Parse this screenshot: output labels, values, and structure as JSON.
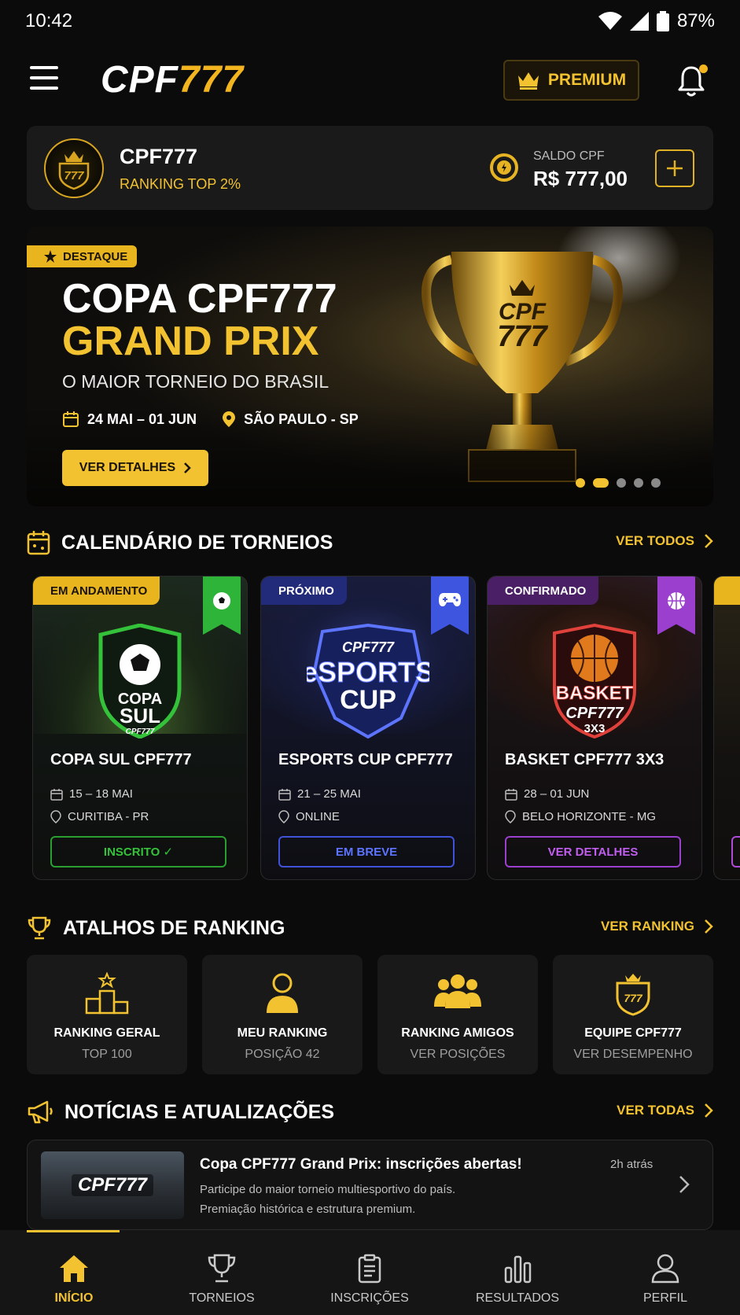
{
  "status_bar": {
    "time": "10:42",
    "battery": "87%"
  },
  "header": {
    "logo_white": "CPF",
    "logo_gold": "777",
    "premium_label": "PREMIUM"
  },
  "user": {
    "name": "CPF777",
    "rank": "RANKING TOP 2%",
    "avatar_text": "777",
    "balance_label": "SALDO CPF",
    "balance_value": "R$ 777,00"
  },
  "hero": {
    "badge": "DESTAQUE",
    "title_line1": "COPA CPF777",
    "title_line2": "GRAND PRIX",
    "subtitle": "O MAIOR TORNEIO DO BRASIL",
    "date": "24 MAI – 01 JUN",
    "location": "SÃO PAULO - SP",
    "cta": "VER DETALHES",
    "trophy_line1": "CPF",
    "trophy_line2": "777",
    "slide_count": 5,
    "active_slide": 2
  },
  "calendar": {
    "title": "CALENDÁRIO DE TORNEIOS",
    "link": "VER TODOS",
    "tournaments": [
      {
        "status": "EM ANDAMENTO",
        "emblem_l1": "COPA",
        "emblem_l2": "SUL",
        "emblem_l3": "CPF777",
        "name": "COPA SUL CPF777",
        "date": "15 – 18 MAI",
        "place": "CURITIBA - PR",
        "button": "INSCRITO ✓",
        "color": "#35c23b"
      },
      {
        "status": "PRÓXIMO",
        "emblem_l1": "CPF777",
        "emblem_l2": "eSPORTS",
        "emblem_l3": "CUP",
        "name": "ESPORTS CUP CPF777",
        "date": "21 – 25 MAI",
        "place": "ONLINE",
        "button": "EM BREVE",
        "color": "#4a5ff0"
      },
      {
        "status": "CONFIRMADO",
        "emblem_l1": "BASKET",
        "emblem_l2": "CPF777",
        "emblem_l3": "3X3",
        "name": "BASKET CPF777 3X3",
        "date": "28 – 01 JUN",
        "place": "BELO HORIZONTE - MG",
        "button": "VER DETALHES",
        "color": "#b04ad8"
      }
    ]
  },
  "ranking": {
    "title": "ATALHOS DE RANKING",
    "link": "VER RANKING",
    "items": [
      {
        "title": "RANKING GERAL",
        "sub": "TOP 100"
      },
      {
        "title": "MEU RANKING",
        "sub": "POSIÇÃO 42"
      },
      {
        "title": "RANKING AMIGOS",
        "sub": "VER POSIÇÕES"
      },
      {
        "title": "EQUIPE CPF777",
        "sub": "VER DESEMPENHO"
      }
    ]
  },
  "news": {
    "title": "NOTÍCIAS E ATUALIZAÇÕES",
    "link": "VER TODAS",
    "item": {
      "thumb_text": "CPF777",
      "headline": "Copa CPF777 Grand Prix: inscrições abertas!",
      "time": "2h atrás",
      "body_line1": "Participe do maior torneio multiesportivo do país.",
      "body_line2": "Premiação histórica e estrutura premium."
    }
  },
  "bottom_nav": [
    {
      "label": "INÍCIO",
      "icon": "home-icon"
    },
    {
      "label": "TORNEIOS",
      "icon": "trophy-icon"
    },
    {
      "label": "INSCRIÇÕES",
      "icon": "clipboard-icon"
    },
    {
      "label": "RESULTADOS",
      "icon": "bar-chart-icon"
    },
    {
      "label": "PERFIL",
      "icon": "user-icon"
    }
  ],
  "colors": {
    "accent": "#f2c230",
    "background": "#0b0b0c",
    "card": "#1a1a1b"
  }
}
